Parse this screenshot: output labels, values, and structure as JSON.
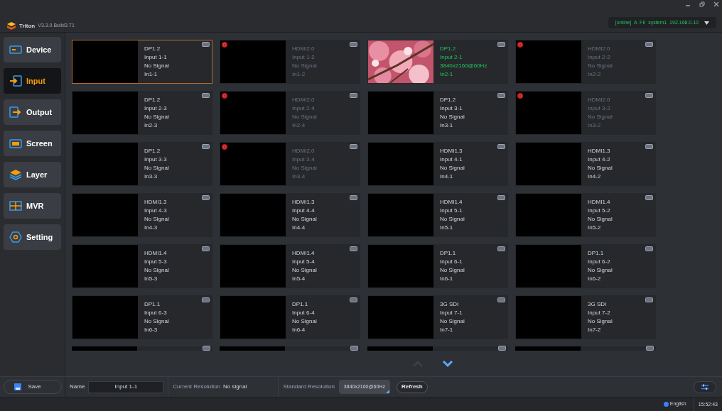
{
  "app": {
    "title": "Triton",
    "version": "V3.3.0.Build3.T1",
    "connection": "[online]  A  FII  system1  192.168.0.10"
  },
  "sidebar": {
    "items": [
      {
        "label": "Device",
        "kind": "device",
        "selected": false
      },
      {
        "label": "Input",
        "kind": "input",
        "selected": true
      },
      {
        "label": "Output",
        "kind": "output",
        "selected": false
      },
      {
        "label": "Screen",
        "kind": "screen",
        "selected": false
      },
      {
        "label": "Layer",
        "kind": "layer",
        "selected": false
      },
      {
        "label": "MVR",
        "kind": "mvr",
        "selected": false
      },
      {
        "label": "Setting",
        "kind": "setting",
        "selected": false
      }
    ],
    "save": "Save"
  },
  "inputs": [
    {
      "kind": "full",
      "connector": "DP1.2",
      "name": "Input 1-1",
      "signal": "No Signal",
      "id": "In1-1",
      "selected": true,
      "disabled": false,
      "live": false
    },
    {
      "kind": "full",
      "connector": "HDMI2.0",
      "name": "Input 1-2",
      "signal": "No Signal",
      "id": "In1-2",
      "selected": false,
      "disabled": true,
      "live": false
    },
    {
      "kind": "full",
      "connector": "DP1.2",
      "name": "Input 2-1",
      "signal": "3840x2160@60Hz",
      "id": "In2-1",
      "selected": false,
      "disabled": false,
      "live": true
    },
    {
      "kind": "full",
      "connector": "HDMI2.0",
      "name": "Input 2-2",
      "signal": "No Signal",
      "id": "In2-2",
      "selected": false,
      "disabled": true,
      "live": false
    },
    {
      "kind": "full",
      "connector": "DP1.2",
      "name": "Input 2-3",
      "signal": "No Signal",
      "id": "In2-3",
      "selected": false,
      "disabled": false,
      "live": false
    },
    {
      "kind": "full",
      "connector": "HDMI2.0",
      "name": "Input 2-4",
      "signal": "No Signal",
      "id": "In2-4",
      "selected": false,
      "disabled": true,
      "live": false
    },
    {
      "kind": "full",
      "connector": "DP1.2",
      "name": "Input 3-1",
      "signal": "No Signal",
      "id": "In3-1",
      "selected": false,
      "disabled": false,
      "live": false
    },
    {
      "kind": "full",
      "connector": "HDMI2.0",
      "name": "Input 3-2",
      "signal": "No Signal",
      "id": "In3-2",
      "selected": false,
      "disabled": true,
      "live": false
    },
    {
      "kind": "full",
      "connector": "DP1.2",
      "name": "Input 3-3",
      "signal": "No Signal",
      "id": "In3-3",
      "selected": false,
      "disabled": false,
      "live": false
    },
    {
      "kind": "full",
      "connector": "HDMI2.0",
      "name": "Input 3-4",
      "signal": "No Signal",
      "id": "In3-4",
      "selected": false,
      "disabled": true,
      "live": false
    },
    {
      "kind": "full",
      "connector": "HDMI1.3",
      "name": "Input 4-1",
      "signal": "No Signal",
      "id": "In4-1",
      "selected": false,
      "disabled": false,
      "live": false
    },
    {
      "kind": "full",
      "connector": "HDMI1.3",
      "name": "Input 4-2",
      "signal": "No Signal",
      "id": "In4-2",
      "selected": false,
      "disabled": false,
      "live": false
    },
    {
      "kind": "full",
      "connector": "HDMI1.3",
      "name": "Input 4-3",
      "signal": "No Signal",
      "id": "In4-3",
      "selected": false,
      "disabled": false,
      "live": false
    },
    {
      "kind": "full",
      "connector": "HDMI1.3",
      "name": "Input 4-4",
      "signal": "No Signal",
      "id": "In4-4",
      "selected": false,
      "disabled": false,
      "live": false
    },
    {
      "kind": "full",
      "connector": "HDMI1.4",
      "name": "Input 5-1",
      "signal": "No Signal",
      "id": "In5-1",
      "selected": false,
      "disabled": false,
      "live": false
    },
    {
      "kind": "full",
      "connector": "HDMI1.4",
      "name": "Input 5-2",
      "signal": "No Signal",
      "id": "In5-2",
      "selected": false,
      "disabled": false,
      "live": false
    },
    {
      "kind": "full",
      "connector": "HDMI1.4",
      "name": "Input 5-3",
      "signal": "No Signal",
      "id": "In5-3",
      "selected": false,
      "disabled": false,
      "live": false
    },
    {
      "kind": "full",
      "connector": "HDMI1.4",
      "name": "Input 5-4",
      "signal": "No Signal",
      "id": "In5-4",
      "selected": false,
      "disabled": false,
      "live": false
    },
    {
      "kind": "full",
      "connector": "DP1.1",
      "name": "Input 6-1",
      "signal": "No Signal",
      "id": "In6-1",
      "selected": false,
      "disabled": false,
      "live": false
    },
    {
      "kind": "full",
      "connector": "DP1.1",
      "name": "Input 6-2",
      "signal": "No Signal",
      "id": "In6-2",
      "selected": false,
      "disabled": false,
      "live": false
    },
    {
      "kind": "full",
      "connector": "DP1.1",
      "name": "Input 6-3",
      "signal": "No Signal",
      "id": "In6-3",
      "selected": false,
      "disabled": false,
      "live": false
    },
    {
      "kind": "full",
      "connector": "DP1.1",
      "name": "Input 6-4",
      "signal": "No Signal",
      "id": "In6-4",
      "selected": false,
      "disabled": false,
      "live": false
    },
    {
      "kind": "full",
      "connector": "3G SDI",
      "name": "Input 7-1",
      "signal": "No Signal",
      "id": "In7-1",
      "selected": false,
      "disabled": false,
      "live": false
    },
    {
      "kind": "full",
      "connector": "3G SDI",
      "name": "Input 7-2",
      "signal": "No Signal",
      "id": "In7-2",
      "selected": false,
      "disabled": false,
      "live": false
    },
    {
      "kind": "cut"
    },
    {
      "kind": "cut"
    },
    {
      "kind": "cut"
    },
    {
      "kind": "cut"
    }
  ],
  "details": {
    "name_label": "Name",
    "name_value": "Input 1-1",
    "current_label": "Current Resolution",
    "current_value": "No signal",
    "standard_label": "Standard Resolution",
    "standard_value": "3840x2160@60Hz",
    "refresh": "Refresh"
  },
  "status_bar": {
    "language": "English",
    "time": "15:52:43"
  }
}
